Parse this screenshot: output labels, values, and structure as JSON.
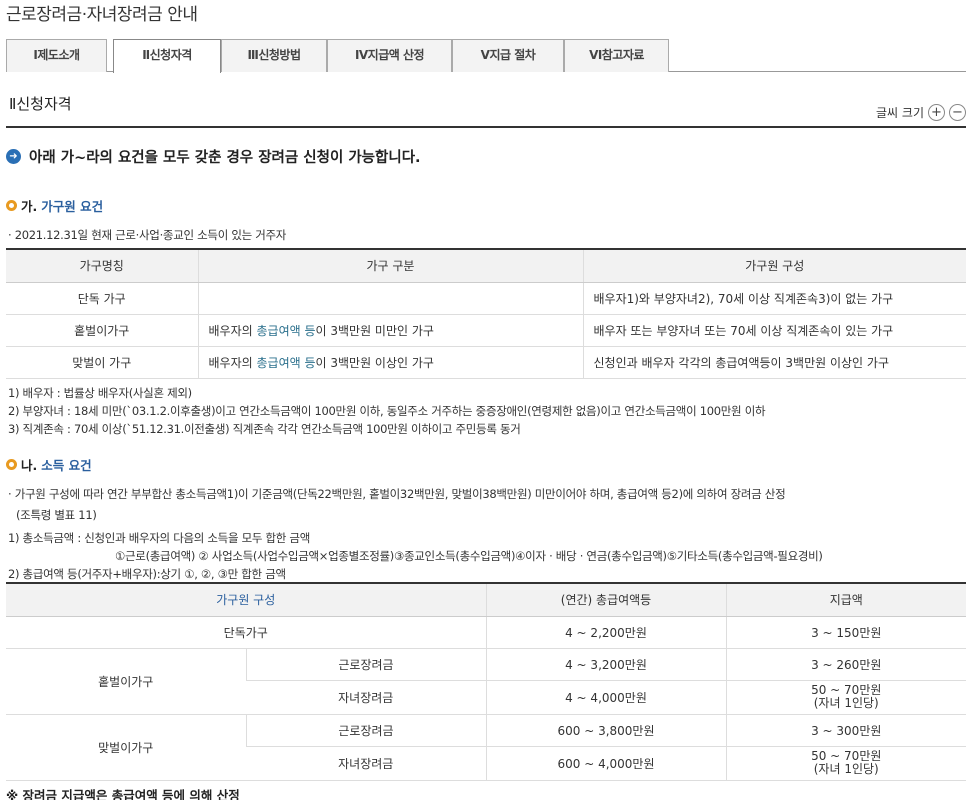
{
  "page": {
    "title": "근로장려금·자녀장려금 안내"
  },
  "tabs": [
    {
      "label": "Ⅰ제도소개"
    },
    {
      "label": "Ⅱ신청자격",
      "active": true
    },
    {
      "label": "Ⅲ신청방법"
    },
    {
      "label": "Ⅳ지급액 산정"
    },
    {
      "label": "Ⅴ지급 절차"
    },
    {
      "label": "Ⅵ참고자료"
    }
  ],
  "section": {
    "title": "Ⅱ신청자격",
    "font_size_label": "글씨 크기",
    "font_plus": "+",
    "font_minus": "−"
  },
  "lead": "아래 가~라의 요건을 모두 갖춘 경우 장려금 신청이 가능합니다.",
  "household": {
    "prefix": "가.",
    "heading": "가구원 요건",
    "note": "· 2021.12.31일 현재 근로·사업·종교인 소득이 있는 거주자",
    "headers": [
      "가구명칭",
      "가구 구분",
      "가구원 구성"
    ],
    "rows": [
      {
        "name": "단독 가구",
        "cat_a": "",
        "cat_hl": "",
        "cat_b": "",
        "members": "배우자1)와 부양자녀2), 70세 이상 직계존속3)이 없는 가구"
      },
      {
        "name": "홑벌이가구",
        "cat_a": "배우자의 ",
        "cat_hl": "총급여액 등",
        "cat_b": "이 3백만원 미만인 가구",
        "members": "배우자 또는 부양자녀 또는 70세 이상 직계존속이 있는 가구"
      },
      {
        "name": "맞벌이 가구",
        "cat_a": "배우자의 ",
        "cat_hl": "총급여액 등",
        "cat_b": "이 3백만원 이상인 가구",
        "members": "신청인과 배우자 각각의 총급여액등이 3백만원 이상인 가구"
      }
    ],
    "footnotes": [
      "1) 배우자 : 법률상 배우자(사실혼 제외)",
      "2) 부양자녀 : 18세 미만(`03.1.2.이후출생)이고 연간소득금액이 100만원 이하, 동일주소 거주하는 중증장애인(연령제한 없음)이고 연간소득금액이 100만원 이하",
      "3) 직계존속 : 70세 이상(`51.12.31.이전출생) 직계존속 각각 연간소득금액 100만원 이하이고 주민등록 동거"
    ]
  },
  "income": {
    "prefix": "나.",
    "heading": "소득 요건",
    "desc1": "· 가구원 구성에 따라 연간 부부합산 총소득금액1)이 기준금액(단독22백만원, 홑벌이32백만원, 맞벌이38백만원) 미만이어야 하며, 총급여액 등2)에 의하여 장려금 산정",
    "desc2": "(조특령 별표 11)",
    "notes": [
      "1) 총소득금액 : 신청인과 배우자의 다음의 소득을 모두 합한 금액",
      "①근로(총급여액) ② 사업소득(사업수입금액×업종별조정률)③종교인소득(총수입금액)④이자 · 배당 · 연금(총수입금액)⑤기타소득(총수입금액-필요경비)",
      "2) 총급여액 등(거주자+배우자):상기 ①, ②, ③만 합한 금액"
    ],
    "headers": [
      "가구원 구성",
      "(연간) 총급여액등",
      "지급액"
    ],
    "single": {
      "label": "단독가구",
      "range": "4 ~ 2,200만원",
      "amount": "3 ~ 150만원"
    },
    "one_earner": {
      "label": "홑벌이가구",
      "rows": [
        {
          "type": "근로장려금",
          "range": "4 ~ 3,200만원",
          "amount": "3 ~ 260만원",
          "amount2": ""
        },
        {
          "type": "자녀장려금",
          "range": "4 ~ 4,000만원",
          "amount": "50 ~ 70만원",
          "amount2": "(자녀 1인당)"
        }
      ]
    },
    "dual_earner": {
      "label": "맞벌이가구",
      "rows": [
        {
          "type": "근로장려금",
          "range": "600 ~ 3,800만원",
          "amount": "3 ~ 300만원",
          "amount2": ""
        },
        {
          "type": "자녀장려금",
          "range": "600 ~ 4,000만원",
          "amount": "50 ~ 70만원",
          "amount2": "(자녀 1인당)"
        }
      ]
    }
  },
  "bottom_note": "※ 장려금 지급액은 총급여액 등에 의해 산정"
}
